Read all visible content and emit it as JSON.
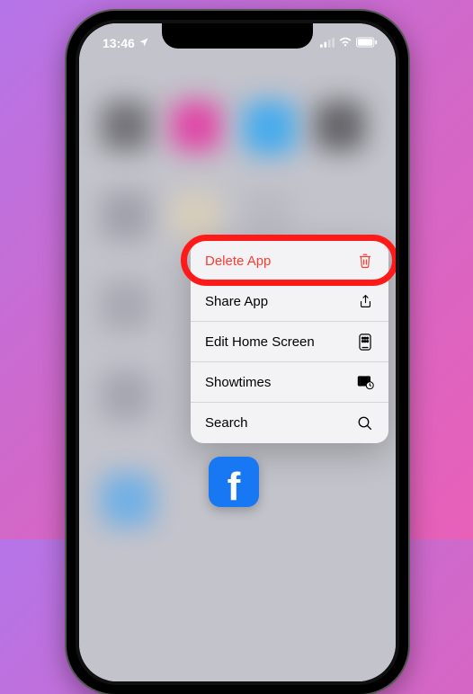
{
  "status": {
    "time": "13:46",
    "location_icon": "location-arrow"
  },
  "context_menu": {
    "items": [
      {
        "label": "Delete App",
        "icon": "trash-icon",
        "destructive": true
      },
      {
        "label": "Share App",
        "icon": "share-icon",
        "destructive": false
      },
      {
        "label": "Edit Home Screen",
        "icon": "edit-home-icon",
        "destructive": false
      },
      {
        "label": "Showtimes",
        "icon": "showtimes-icon",
        "destructive": false
      },
      {
        "label": "Search",
        "icon": "search-icon",
        "destructive": false
      }
    ]
  },
  "app": {
    "name": "Facebook",
    "glyph": "f"
  },
  "annotation": {
    "highlighted_item_index": 0
  }
}
